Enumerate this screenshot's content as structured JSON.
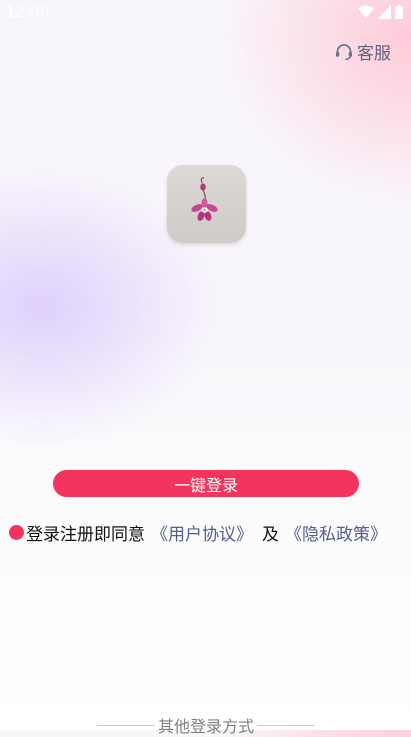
{
  "status_bar": {
    "time": "12:00"
  },
  "header": {
    "service_label": "客服"
  },
  "login": {
    "one_click_label": "一键登录"
  },
  "agreement": {
    "prefix": "登录注册即同意",
    "user_agreement": "《用户协议》",
    "conjunction": "及",
    "privacy_policy": "《隐私政策》"
  },
  "footer": {
    "other_methods": "其他登录方式"
  },
  "colors": {
    "accent": "#f5335f",
    "link": "#4f5f8f"
  },
  "icons": [
    "wifi-icon",
    "signal-icon",
    "battery-icon",
    "headset-icon"
  ]
}
